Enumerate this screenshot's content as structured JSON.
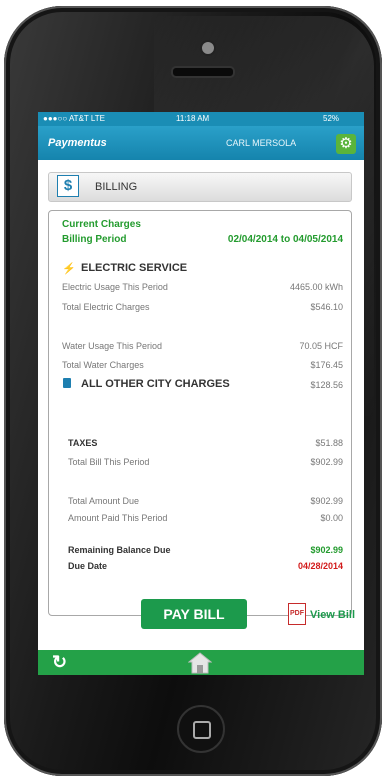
{
  "status": {
    "carrier": "●●●○○ AT&T  LTE",
    "time": "11:18 AM",
    "battery": "52%"
  },
  "header": {
    "logo": "Paymentus",
    "user": "CARL MERSOLA"
  },
  "billing_tab": {
    "label": "BILLING"
  },
  "charges": {
    "current_charges": "Current Charges",
    "billing_period_label": "Billing Period",
    "billing_period_value": "02/04/2014 to 04/05/2014",
    "electric_service": "ELECTRIC SERVICE",
    "electric_usage_label": "Electric Usage This Period",
    "electric_usage_value": "4465.00 kWh",
    "total_electric_label": "Total Electric Charges",
    "total_electric_value": "$546.10",
    "water_usage_label": "Water Usage This Period",
    "water_usage_value": "70.05 HCF",
    "total_water_label": "Total Water Charges",
    "total_water_value": "$176.45",
    "other_city_label": "ALL OTHER CITY CHARGES",
    "other_city_value": "$128.56",
    "taxes_label": "TAXES",
    "taxes_value": "$51.88",
    "total_bill_label": "Total Bill This Period",
    "total_bill_value": "$902.99",
    "total_due_label": "Total Amount Due",
    "total_due_value": "$902.99",
    "amount_paid_label": "Amount Paid This Period",
    "amount_paid_value": "$0.00",
    "remaining_label": "Remaining Balance Due",
    "remaining_value": "$902.99",
    "due_date_label": "Due Date",
    "due_date_value": "04/28/2014"
  },
  "actions": {
    "pay_bill": "PAY BILL",
    "view_bill": "View Bill"
  },
  "icons": {
    "settings": "gear-icon",
    "billing": "dollar-icon",
    "electric": "electric-icon",
    "other_charges": "document-icon",
    "pdf": "pdf-icon",
    "refresh": "refresh-icon",
    "home": "home-icon"
  },
  "colors": {
    "header_blue": "#1a8db5",
    "accent_green": "#239b2e",
    "due_red": "#d21b1b",
    "pay_button": "#1c9a4c",
    "bottom_bar": "#24a148"
  }
}
